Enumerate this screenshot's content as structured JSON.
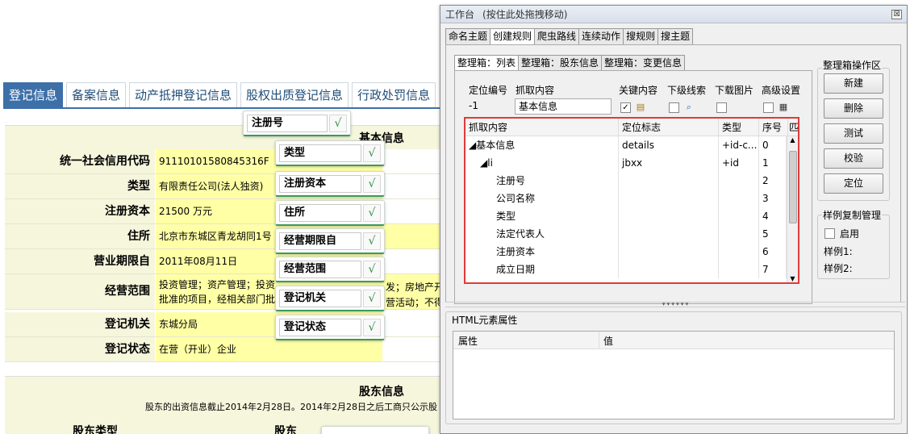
{
  "web": {
    "tabs": [
      {
        "label": "登记信息",
        "active": true
      },
      {
        "label": "备案信息"
      },
      {
        "label": "动产抵押登记信息"
      },
      {
        "label": "股权出质登记信息"
      },
      {
        "label": "行政处罚信息"
      }
    ],
    "basic_title": "基本信息",
    "rows": [
      {
        "key": "统一社会信用代码",
        "value": "91110101580845316F"
      },
      {
        "key": "类型",
        "value": "有限责任公司(法人独资)"
      },
      {
        "key": "注册资本",
        "value": "21500 万元"
      },
      {
        "key": "住所",
        "value": "北京市东城区青龙胡同1号"
      },
      {
        "key": "营业期限自",
        "value": "2011年08月11日"
      },
      {
        "key": "经营范围",
        "value": "投资管理；资产管理；投资",
        "value2": "批准的项目，经相关部门批",
        "tail1": "发；房地产开",
        "tail2": "营活动；不得"
      },
      {
        "key": "登记机关",
        "value": "东城分局"
      },
      {
        "key": "登记状态",
        "value": "在营（开业）企业"
      }
    ],
    "shareholder_title": "股东信息",
    "shareholder_note": "股东的出资信息截止2014年2月28日。2014年2月28日之后工商只公示股",
    "shareholder_col1": "股东类型",
    "shareholder_col2": "股东"
  },
  "popups": [
    "注册号",
    "类型",
    "注册资本",
    "住所",
    "经营期限自",
    "经营范围",
    "登记机关",
    "登记状态"
  ],
  "popup_check": "√",
  "tool": {
    "title": "工作台",
    "title_hint": "(按住此处拖拽移动)",
    "close": "☒",
    "tabs": [
      {
        "label": "命名主题"
      },
      {
        "label": "创建规则",
        "active": true
      },
      {
        "label": "爬虫路线"
      },
      {
        "label": "连续动作"
      },
      {
        "label": "搜规则"
      },
      {
        "label": "搜主题"
      }
    ],
    "subtabs": [
      {
        "label": "整理箱：列表",
        "active": true
      },
      {
        "label": "整理箱：股东信息"
      },
      {
        "label": "整理箱：变更信息"
      }
    ],
    "form": {
      "locate_no_label": "定位编号",
      "locate_no": "-1",
      "capture_label": "抓取内容",
      "capture_value": "基本信息",
      "key_label": "关键内容",
      "nextline_label": "下级线索",
      "download_label": "下载图片",
      "advanced_label": "高级设置"
    },
    "grid": {
      "headers": [
        "抓取内容",
        "定位标志",
        "类型",
        "序号",
        "匹"
      ],
      "rows": [
        {
          "name": "◢基本信息",
          "mark": "details",
          "type": "+id-c...",
          "no": "0"
        },
        {
          "name": "◢li",
          "mark": "jbxx",
          "type": "+id",
          "no": "1"
        },
        {
          "name": "注册号",
          "mark": "",
          "type": "",
          "no": "2"
        },
        {
          "name": "公司名称",
          "mark": "",
          "type": "",
          "no": "3"
        },
        {
          "name": "类型",
          "mark": "",
          "type": "",
          "no": "4"
        },
        {
          "name": "法定代表人",
          "mark": "",
          "type": "",
          "no": "5"
        },
        {
          "name": "注册资本",
          "mark": "",
          "type": "",
          "no": "6"
        },
        {
          "name": "成立日期",
          "mark": "",
          "type": "",
          "no": "7"
        }
      ]
    },
    "ops_title": "整理箱操作区",
    "ops": [
      "新建",
      "删除",
      "测试",
      "校验",
      "定位"
    ],
    "sample_title": "样例复制管理",
    "sample_enable": "启用",
    "sample1": "样例1:",
    "sample2": "样例2:",
    "attr_title": "HTML元素属性",
    "attr_col1": "属性",
    "attr_col2": "值"
  }
}
